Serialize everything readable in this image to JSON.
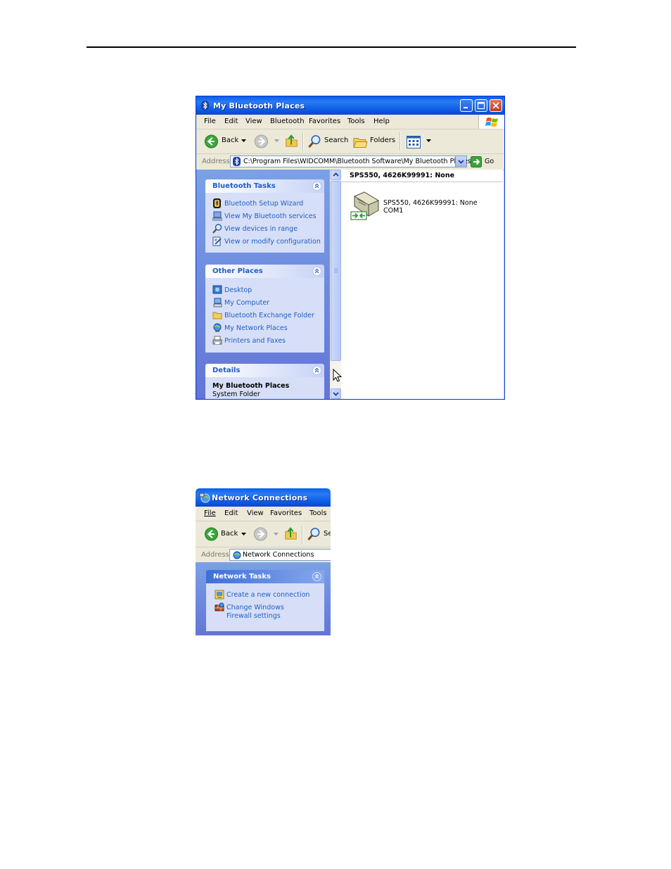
{
  "win1": {
    "title": "My Bluetooth Places",
    "menu": [
      "File",
      "Edit",
      "View",
      "Bluetooth",
      "Favorites",
      "Tools",
      "Help"
    ],
    "toolbar": {
      "back": "Back",
      "search": "Search",
      "folders": "Folders"
    },
    "address": {
      "label": "Address",
      "value": "C:\\Program Files\\WIDCOMM\\Bluetooth Software\\My Bluetooth Places",
      "go": "Go"
    },
    "bluetooth_tasks": {
      "title": "Bluetooth Tasks",
      "items": [
        {
          "label": "Bluetooth Setup Wizard",
          "icon": "bluetooth-wizard-icon"
        },
        {
          "label": "View My Bluetooth services",
          "icon": "computer-services-icon"
        },
        {
          "label": "View devices in range",
          "icon": "magnifier-icon"
        },
        {
          "label": "View or modify configuration",
          "icon": "configuration-icon"
        }
      ]
    },
    "other_places": {
      "title": "Other Places",
      "items": [
        {
          "label": "Desktop",
          "icon": "desktop-icon"
        },
        {
          "label": "My Computer",
          "icon": "my-computer-icon"
        },
        {
          "label": "Bluetooth Exchange Folder",
          "icon": "folder-icon"
        },
        {
          "label": "My Network Places",
          "icon": "network-places-icon"
        },
        {
          "label": "Printers and Faxes",
          "icon": "printer-icon"
        }
      ]
    },
    "details": {
      "title": "Details",
      "name": "My Bluetooth Places",
      "type": "System Folder"
    },
    "list": {
      "column_header": "SPS550, 4626K99991: None",
      "device": {
        "name": "SPS550, 4626K99991: None",
        "port": "COM1",
        "icon": "serial-port-device-icon"
      }
    }
  },
  "win2": {
    "title": "Network Connections",
    "menu": [
      "File",
      "Edit",
      "View",
      "Favorites",
      "Tools"
    ],
    "toolbar": {
      "back": "Back",
      "search": "Se"
    },
    "address": {
      "label": "Address",
      "value": "Network Connections"
    },
    "network_tasks": {
      "title": "Network Tasks",
      "items": [
        {
          "label": "Create a new connection",
          "icon": "new-connection-icon"
        },
        {
          "label": "Change Windows Firewall settings",
          "icon": "firewall-icon"
        }
      ]
    }
  },
  "colors": {
    "title_blue": "#0a5fe8",
    "task_link": "#215dc6",
    "pane_blue": "#6f8fe0",
    "panel_body": "#d6dff7"
  }
}
